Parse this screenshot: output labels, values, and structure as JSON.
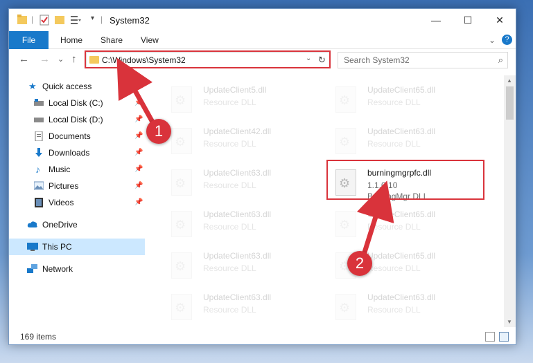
{
  "window": {
    "title": "System32",
    "minimize": "—",
    "maximize": "☐",
    "close": "✕"
  },
  "ribbon": {
    "tabs": [
      "File",
      "Home",
      "Share",
      "View"
    ],
    "expand": "⌄",
    "help": "?"
  },
  "nav": {
    "back": "←",
    "forward": "→",
    "recent": "⌄",
    "up": "↑",
    "address": "C:\\Windows\\System32",
    "dropdown": "⌄",
    "refresh": "↻",
    "search_placeholder": "Search System32"
  },
  "sidebar": {
    "items": [
      {
        "label": "Quick access",
        "icon": "star-icon",
        "pinned": false
      },
      {
        "label": "Local Disk (C:)",
        "icon": "drive-icon",
        "pinned": true
      },
      {
        "label": "Local Disk (D:)",
        "icon": "drive-icon",
        "pinned": true
      },
      {
        "label": "Documents",
        "icon": "documents-icon",
        "pinned": true
      },
      {
        "label": "Downloads",
        "icon": "downloads-icon",
        "pinned": true
      },
      {
        "label": "Music",
        "icon": "music-icon",
        "pinned": true
      },
      {
        "label": "Pictures",
        "icon": "pictures-icon",
        "pinned": true
      },
      {
        "label": "Videos",
        "icon": "videos-icon",
        "pinned": true
      },
      {
        "label": "OneDrive",
        "icon": "cloud-icon",
        "pinned": false
      },
      {
        "label": "This PC",
        "icon": "computer-icon",
        "pinned": false,
        "selected": true
      },
      {
        "label": "Network",
        "icon": "network-icon",
        "pinned": false
      }
    ]
  },
  "files": [
    {
      "name": "UpdateClient5.dll",
      "line2": "Resource DLL",
      "line3": "",
      "faded": true
    },
    {
      "name": "UpdateClient65.dll",
      "line2": "Resource DLL",
      "line3": "",
      "faded": true
    },
    {
      "name": "UpdateClient42.dll",
      "line2": "Resource DLL",
      "line3": "",
      "faded": true
    },
    {
      "name": "UpdateClient63.dll",
      "line2": "Resource DLL",
      "line3": "",
      "faded": true
    },
    {
      "name": "UpdateClient63.dll",
      "line2": "Resource DLL",
      "line3": "",
      "faded": true
    },
    {
      "name": "burningmgrpfc.dll",
      "line2": "1.1.0.10",
      "line3": "BurningMgr DLL",
      "faded": false
    },
    {
      "name": "UpdateClient63.dll",
      "line2": "Resource DLL",
      "line3": "",
      "faded": true
    },
    {
      "name": "UpdateClient65.dll",
      "line2": "Resource DLL",
      "line3": "",
      "faded": true
    },
    {
      "name": "UpdateClient63.dll",
      "line2": "Resource DLL",
      "line3": "",
      "faded": true
    },
    {
      "name": "UpdateClient65.dll",
      "line2": "Resource DLL",
      "line3": "",
      "faded": true
    },
    {
      "name": "UpdateClient63.dll",
      "line2": "Resource DLL",
      "line3": "",
      "faded": true
    },
    {
      "name": "UpdateClient63.dll",
      "line2": "Resource DLL",
      "line3": "",
      "faded": true
    }
  ],
  "status": {
    "items_count": "169 items"
  },
  "annotations": {
    "step1": "1",
    "step2": "2",
    "color": "#d9333b"
  }
}
